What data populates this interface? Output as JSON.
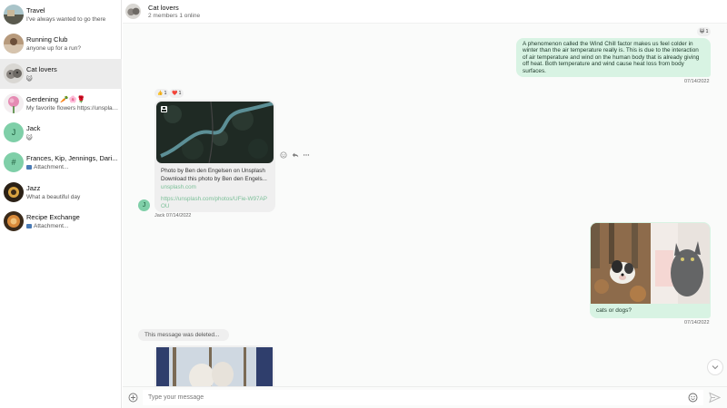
{
  "sidebar": {
    "conversations": [
      {
        "name": "Travel",
        "preview": "I've always wanted to go there"
      },
      {
        "name": "Running Club",
        "preview": "anyone up for a run?"
      },
      {
        "name": "Cat lovers",
        "preview": "😺"
      },
      {
        "name": "Gerdening 🥕🌸🌹",
        "preview": "My favorite flowers https://unsplash.com"
      },
      {
        "name": "Jack",
        "preview": "😺",
        "avatar_letter": "J"
      },
      {
        "name": "Frances, Kip, Jennings, Dari...",
        "preview": "Attachment...",
        "avatar_letter": "#"
      },
      {
        "name": "Jazz",
        "preview": "What a beautiful day"
      },
      {
        "name": "Recipe Exchange",
        "preview": "Attachment..."
      }
    ]
  },
  "header": {
    "title": "Cat lovers",
    "subtitle": "2 members 1 online"
  },
  "chat": {
    "msg1": {
      "reaction": "😺 1",
      "text": "A phenomenon called the Wind Chill factor makes us feel colder in winter than the air temperature really is. This is due to the interaction of air temperature and wind on the human body that is already giving off heat. Both temperature and wind cause heat loss from body surfaces.",
      "time": "07/14/2022"
    },
    "msg2": {
      "reactions": [
        "👍 1",
        "❤️ 1"
      ],
      "link_caption": "Photo by Ben den Engelsen on Unsplash",
      "link_desc": "Download this photo by Ben den Engels...",
      "link_domain": "unsplash.com",
      "link_url": "https://unsplash.com/photos/UFie-W97APOU",
      "author": "Jack",
      "time": "07/14/2022",
      "author_letter": "J"
    },
    "msg3": {
      "text": "cats or dogs?",
      "time": "07/14/2022"
    },
    "deleted_text": "This message was deleted..."
  },
  "composer": {
    "placeholder": "Type your message"
  },
  "colors": {
    "accent": "#7fcfa8",
    "out_bubble": "#d8f3e3",
    "active_conv": "#ececec"
  }
}
